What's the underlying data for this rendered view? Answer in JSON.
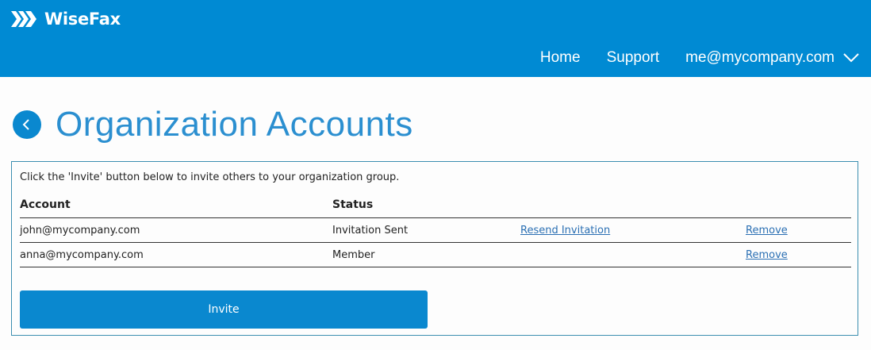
{
  "app": {
    "logo_text": "WiseFax"
  },
  "nav": {
    "home": "Home",
    "support": "Support",
    "user_email": "me@mycompany.com"
  },
  "page": {
    "title": "Organization Accounts",
    "intro": "Click the 'Invite' button below to invite others to your organization group."
  },
  "table": {
    "headers": {
      "account": "Account",
      "status": "Status"
    },
    "rows": [
      {
        "account": "john@mycompany.com",
        "status": "Invitation Sent",
        "resend": "Resend Invitation",
        "remove": "Remove"
      },
      {
        "account": "anna@mycompany.com",
        "status": "Member",
        "resend": "",
        "remove": "Remove"
      }
    ]
  },
  "actions": {
    "invite_label": "Invite"
  },
  "colors": {
    "brand_blue": "#008ad3",
    "title_blue": "#2b8fd0",
    "link_blue": "#2a6fb3",
    "panel_border": "#3c8fb0"
  },
  "icons": {
    "logo": "wisefax-chevrons-icon",
    "back": "chevron-left-icon",
    "user_menu": "chevron-down-icon"
  }
}
